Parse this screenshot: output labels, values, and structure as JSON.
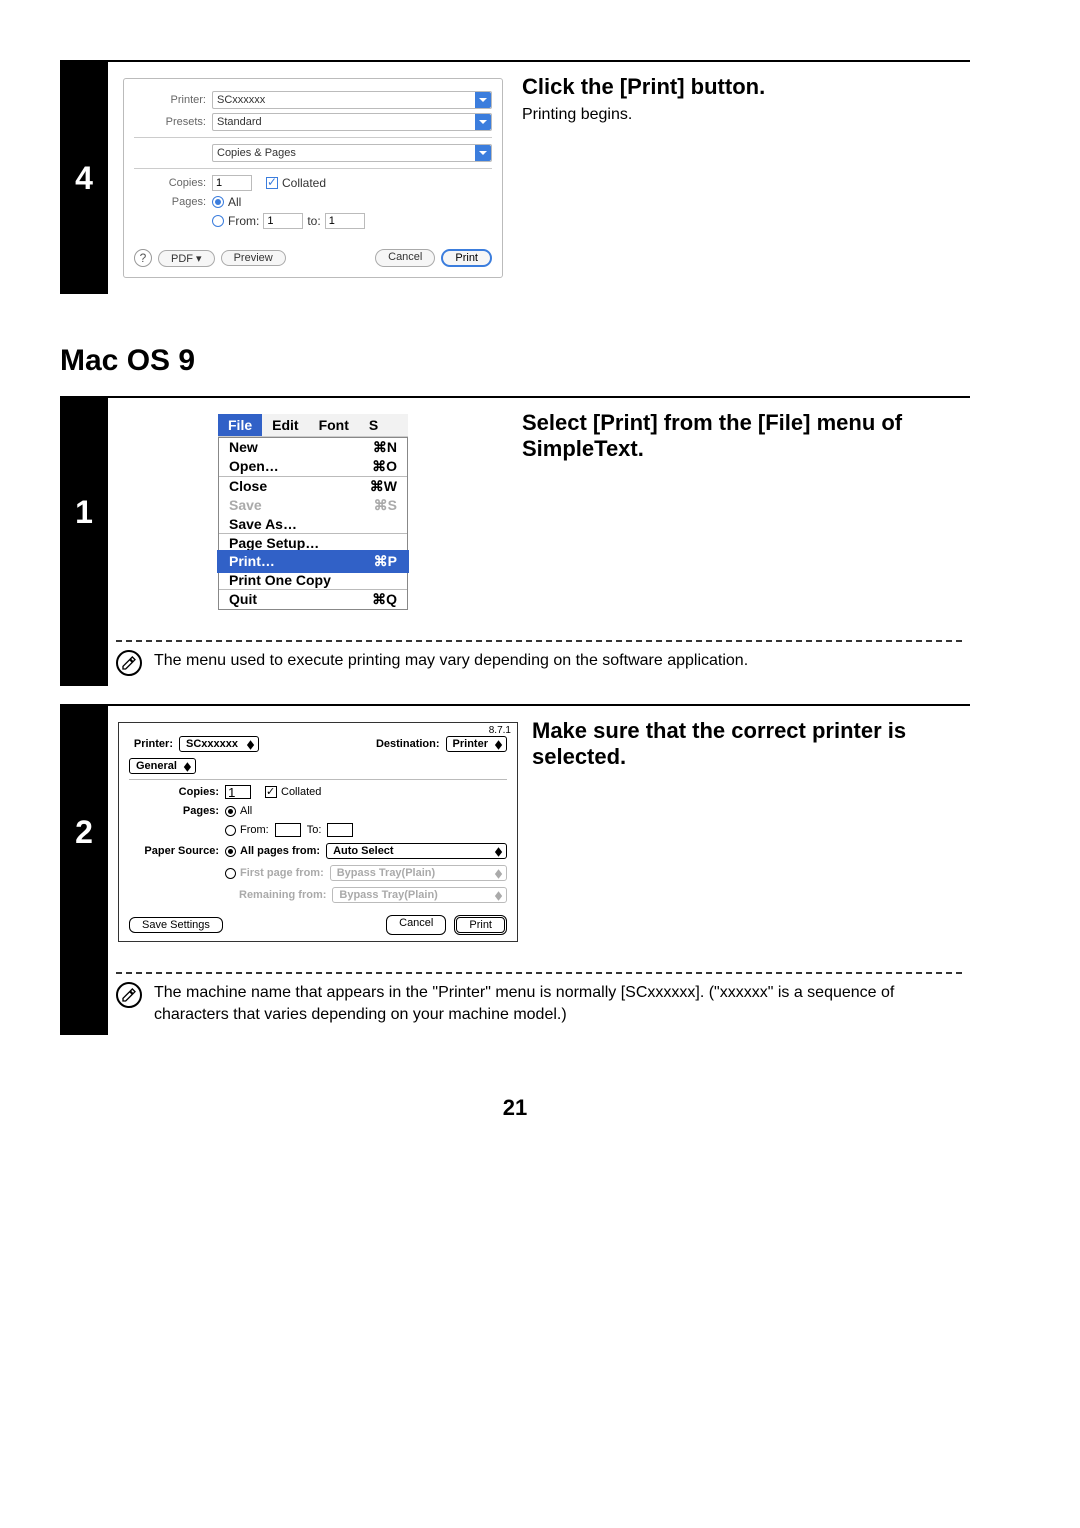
{
  "step4": {
    "num": "4",
    "title": "Click the [Print] button.",
    "desc": "Printing begins.",
    "dialog": {
      "printer_lbl": "Printer:",
      "printer_val": "SCxxxxxx",
      "presets_lbl": "Presets:",
      "presets_val": "Standard",
      "panel_val": "Copies & Pages",
      "copies_lbl": "Copies:",
      "copies_val": "1",
      "collated": "Collated",
      "pages_lbl": "Pages:",
      "all": "All",
      "from_lbl": "From:",
      "from_val": "1",
      "to_lbl": "to:",
      "to_val": "1",
      "help": "?",
      "pdf_btn": "PDF ▾",
      "preview_btn": "Preview",
      "cancel_btn": "Cancel",
      "print_btn": "Print"
    }
  },
  "section_macos9": "Mac OS 9",
  "step1": {
    "num": "1",
    "title": "Select [Print] from the [File] menu of SimpleText.",
    "menubar": {
      "file": "File",
      "edit": "Edit",
      "font": "Font",
      "s": "S"
    },
    "items": [
      {
        "label": "New",
        "key": "⌘N"
      },
      {
        "label": "Open…",
        "key": "⌘O"
      },
      {
        "sep": true
      },
      {
        "label": "Close",
        "key": "⌘W"
      },
      {
        "label": "Save",
        "key": "⌘S",
        "dim": true
      },
      {
        "label": "Save As…"
      },
      {
        "sep": true
      },
      {
        "label": "Page Setup…"
      },
      {
        "label": "Print…",
        "key": "⌘P",
        "hl": true
      },
      {
        "label": "Print One Copy"
      },
      {
        "sep": true
      },
      {
        "label": "Quit",
        "key": "⌘Q"
      }
    ],
    "note": "The menu used to execute printing may vary depending on the software application."
  },
  "step2": {
    "num": "2",
    "title": "Make sure that the correct printer is selected.",
    "dialog": {
      "version": "8.7.1",
      "printer_lbl": "Printer:",
      "printer_val": "SCxxxxxx",
      "dest_lbl": "Destination:",
      "dest_val": "Printer",
      "tab_val": "General",
      "copies_lbl": "Copies:",
      "copies_val": "1",
      "collated": "Collated",
      "pages_lbl": "Pages:",
      "all": "All",
      "from_lbl": "From:",
      "to_lbl": "To:",
      "papersrc_lbl": "Paper Source:",
      "allpages_lbl": "All pages from:",
      "allpages_val": "Auto Select",
      "firstpage_lbl": "First page from:",
      "firstpage_val": "Bypass Tray(Plain)",
      "remaining_lbl": "Remaining from:",
      "remaining_val": "Bypass Tray(Plain)",
      "save_btn": "Save Settings",
      "cancel_btn": "Cancel",
      "print_btn": "Print"
    },
    "note": "The machine name that appears in the \"Printer\" menu is normally [SCxxxxxx]. (\"xxxxxx\" is a sequence of characters that varies depending on your machine model.)"
  },
  "page_number": "21"
}
